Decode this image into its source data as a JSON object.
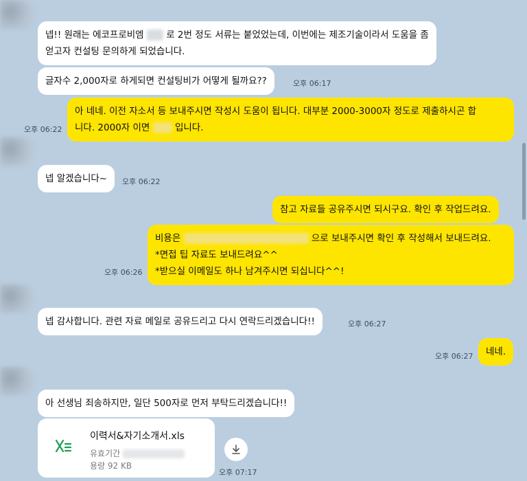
{
  "messages": [
    {
      "side": "in",
      "line1": "넵!! 원래는 에코프로비엠",
      "line1_after": "로 2번 정도 서류는 붙었었는데, 이번에는 제조기술이라서 도움을 좀",
      "line2": "얻고자 컨설팅 문의하게 되었습니다."
    },
    {
      "side": "in",
      "text": "글자수 2,000자로 하게되면 컨설팅비가 어떻게 될까요??",
      "time": "오후 06:17"
    },
    {
      "side": "out",
      "line1": "아 네네. 이전 자소서 등 보내주시면 작성시 도움이 됩니다. 대부분 2000-3000자 정도로 제출하시곤 합",
      "line2_before": "니다. 2000자 이면",
      "line2_after": "입니다.",
      "time": "오후 06:22"
    },
    {
      "side": "in",
      "text": "넵 알겠습니다~",
      "time": "오후 06:22"
    },
    {
      "side": "out",
      "text": "참고 자료들 공유주시면 되시구요. 확인 후 작업드려요."
    },
    {
      "side": "out",
      "line1_before": "비용은",
      "line1_after": "으로 보내주시면 확인 후 작성해서 보내드려요.",
      "line2": "*면접 팁 자료도 보내드려요^^",
      "line3": "*받으실 이메일도 하나 남겨주시면 되십니다^^!",
      "time": "오후 06:26"
    },
    {
      "side": "in",
      "text": "넵 감사합니다. 관련 자료 메일로 공유드리고 다시 연락드리겠습니다!!",
      "time": "오후 06:27"
    },
    {
      "side": "out",
      "text": "네네.",
      "time": "오후 06:27"
    },
    {
      "side": "in",
      "text": "아 선생님 죄송하지만, 일단 500자로 먼저 부탁드리겠습니다!!"
    }
  ],
  "file": {
    "name": "이력서&자기소개서.xls",
    "validity_label": "유효기간",
    "size_label": "용량 92 KB",
    "time": "오후 07:17",
    "icon": "excel-file-icon",
    "icon_color": "#1f9d55",
    "download_icon": "download-icon"
  },
  "colors": {
    "background": "#bacee0",
    "incoming": "#ffffff",
    "outgoing": "#fee500"
  }
}
